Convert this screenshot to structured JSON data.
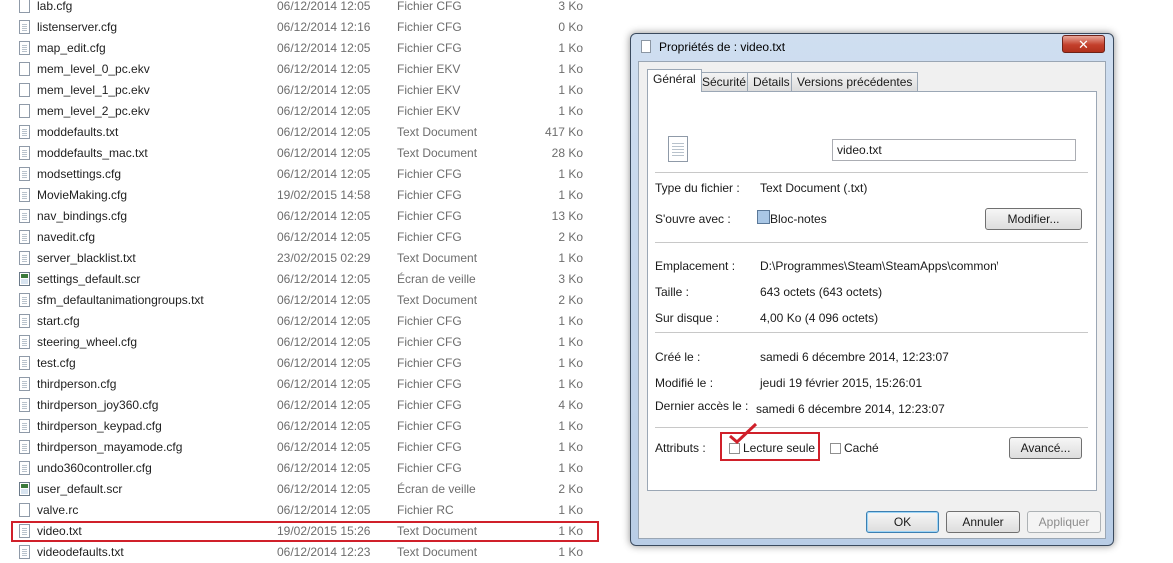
{
  "files": [
    {
      "name": "lab.cfg",
      "date": "06/12/2014 12:05",
      "type": "Fichier CFG",
      "size": "3 Ko",
      "icon": "file-icon"
    },
    {
      "name": "listenserver.cfg",
      "date": "06/12/2014 12:16",
      "type": "Fichier CFG",
      "size": "0 Ko",
      "icon": "text-file-icon"
    },
    {
      "name": "map_edit.cfg",
      "date": "06/12/2014 12:05",
      "type": "Fichier CFG",
      "size": "1 Ko",
      "icon": "text-file-icon"
    },
    {
      "name": "mem_level_0_pc.ekv",
      "date": "06/12/2014 12:05",
      "type": "Fichier EKV",
      "size": "1 Ko",
      "icon": "file-icon"
    },
    {
      "name": "mem_level_1_pc.ekv",
      "date": "06/12/2014 12:05",
      "type": "Fichier EKV",
      "size": "1 Ko",
      "icon": "file-icon"
    },
    {
      "name": "mem_level_2_pc.ekv",
      "date": "06/12/2014 12:05",
      "type": "Fichier EKV",
      "size": "1 Ko",
      "icon": "file-icon"
    },
    {
      "name": "moddefaults.txt",
      "date": "06/12/2014 12:05",
      "type": "Text Document",
      "size": "417 Ko",
      "icon": "text-file-icon"
    },
    {
      "name": "moddefaults_mac.txt",
      "date": "06/12/2014 12:05",
      "type": "Text Document",
      "size": "28 Ko",
      "icon": "text-file-icon"
    },
    {
      "name": "modsettings.cfg",
      "date": "06/12/2014 12:05",
      "type": "Fichier CFG",
      "size": "1 Ko",
      "icon": "text-file-icon"
    },
    {
      "name": "MovieMaking.cfg",
      "date": "19/02/2015 14:58",
      "type": "Fichier CFG",
      "size": "1 Ko",
      "icon": "text-file-icon"
    },
    {
      "name": "nav_bindings.cfg",
      "date": "06/12/2014 12:05",
      "type": "Fichier CFG",
      "size": "13 Ko",
      "icon": "text-file-icon"
    },
    {
      "name": "navedit.cfg",
      "date": "06/12/2014 12:05",
      "type": "Fichier CFG",
      "size": "2 Ko",
      "icon": "text-file-icon"
    },
    {
      "name": "server_blacklist.txt",
      "date": "23/02/2015 02:29",
      "type": "Text Document",
      "size": "1 Ko",
      "icon": "text-file-icon"
    },
    {
      "name": "settings_default.scr",
      "date": "06/12/2014 12:05",
      "type": "Écran de veille",
      "size": "3 Ko",
      "icon": "screensaver-icon"
    },
    {
      "name": "sfm_defaultanimationgroups.txt",
      "date": "06/12/2014 12:05",
      "type": "Text Document",
      "size": "2 Ko",
      "icon": "text-file-icon"
    },
    {
      "name": "start.cfg",
      "date": "06/12/2014 12:05",
      "type": "Fichier CFG",
      "size": "1 Ko",
      "icon": "text-file-icon"
    },
    {
      "name": "steering_wheel.cfg",
      "date": "06/12/2014 12:05",
      "type": "Fichier CFG",
      "size": "1 Ko",
      "icon": "text-file-icon"
    },
    {
      "name": "test.cfg",
      "date": "06/12/2014 12:05",
      "type": "Fichier CFG",
      "size": "1 Ko",
      "icon": "text-file-icon"
    },
    {
      "name": "thirdperson.cfg",
      "date": "06/12/2014 12:05",
      "type": "Fichier CFG",
      "size": "1 Ko",
      "icon": "text-file-icon"
    },
    {
      "name": "thirdperson_joy360.cfg",
      "date": "06/12/2014 12:05",
      "type": "Fichier CFG",
      "size": "4 Ko",
      "icon": "text-file-icon"
    },
    {
      "name": "thirdperson_keypad.cfg",
      "date": "06/12/2014 12:05",
      "type": "Fichier CFG",
      "size": "1 Ko",
      "icon": "text-file-icon"
    },
    {
      "name": "thirdperson_mayamode.cfg",
      "date": "06/12/2014 12:05",
      "type": "Fichier CFG",
      "size": "1 Ko",
      "icon": "text-file-icon"
    },
    {
      "name": "undo360controller.cfg",
      "date": "06/12/2014 12:05",
      "type": "Fichier CFG",
      "size": "1 Ko",
      "icon": "text-file-icon"
    },
    {
      "name": "user_default.scr",
      "date": "06/12/2014 12:05",
      "type": "Écran de veille",
      "size": "2 Ko",
      "icon": "screensaver-icon"
    },
    {
      "name": "valve.rc",
      "date": "06/12/2014 12:05",
      "type": "Fichier RC",
      "size": "1 Ko",
      "icon": "file-icon"
    },
    {
      "name": "video.txt",
      "date": "19/02/2015 15:26",
      "type": "Text Document",
      "size": "1 Ko",
      "icon": "text-file-icon",
      "selected": true
    },
    {
      "name": "videodefaults.txt",
      "date": "06/12/2014 12:23",
      "type": "Text Document",
      "size": "1 Ko",
      "icon": "text-file-icon"
    }
  ],
  "dialog": {
    "title": "Propriétés de : video.txt",
    "close_label": "✕",
    "tabs": [
      "Général",
      "Sécurité",
      "Détails",
      "Versions précédentes"
    ],
    "active_tab": "Général",
    "file_name": "video.txt",
    "type_label": "Type du fichier :",
    "type_value": "Text Document (.txt)",
    "opens_with_label": "S'ouvre avec :",
    "opens_with_value": "Bloc-notes",
    "change_button": "Modifier...",
    "location_label": "Emplacement :",
    "location_value": "D:\\Programmes\\Steam\\SteamApps\\common\\Cour",
    "size_label": "Taille :",
    "size_value": "643 octets (643 octets)",
    "disk_label": "Sur disque :",
    "disk_value": "4,00 Ko (4 096 octets)",
    "created_label": "Créé le :",
    "created_value": "samedi 6 décembre 2014, 12:23:07",
    "modified_label": "Modifié le :",
    "modified_value": "jeudi 19 février 2015, 15:26:01",
    "accessed_label": "Dernier accès le :",
    "accessed_value": "samedi 6 décembre 2014, 12:23:07",
    "attributes_label": "Attributs :",
    "readonly_label": "Lecture seule",
    "hidden_label": "Caché",
    "advanced_button": "Avancé...",
    "ok_button": "OK",
    "cancel_button": "Annuler",
    "apply_button": "Appliquer"
  },
  "colors": {
    "highlight": "#d0202a",
    "accent": "#3c7fb1"
  }
}
